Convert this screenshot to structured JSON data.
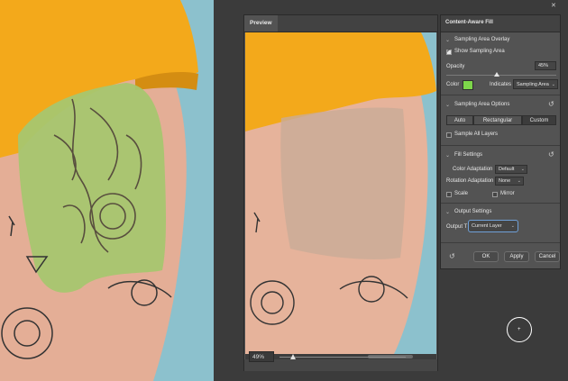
{
  "preview": {
    "tab_label": "Preview",
    "zoom": "49%"
  },
  "caf": {
    "title": "Content-Aware Fill",
    "sampling_overlay": {
      "heading": "Sampling Area Overlay",
      "show_label": "Show Sampling Area",
      "show_checked": true,
      "opacity_label": "Opacity",
      "opacity_value": "45%",
      "color_label": "Color",
      "color_swatch": "#7dd64a",
      "indicates_label": "Indicates",
      "indicates_value": "Sampling Area"
    },
    "sampling_options": {
      "heading": "Sampling Area Options",
      "auto": "Auto",
      "rectangular": "Rectangular",
      "custom": "Custom",
      "sample_all": "Sample All Layers"
    },
    "fill_settings": {
      "heading": "Fill Settings",
      "color_adapt_label": "Color Adaptation",
      "color_adapt_value": "Default",
      "rotation_label": "Rotation Adaptation",
      "rotation_value": "None",
      "scale_label": "Scale",
      "mirror_label": "Mirror"
    },
    "output_settings": {
      "heading": "Output Settings",
      "output_label": "Output T",
      "output_value": "Current Layer"
    },
    "buttons": {
      "ok": "OK",
      "apply": "Apply",
      "cancel": "Cancel"
    }
  },
  "colors": {
    "sampling_green": "#9fc56a",
    "shirt": "#f2a81e",
    "skin": "#e6b29a",
    "background": "#8cc1cd",
    "accent_focus": "#6fa0d8"
  },
  "icons": {
    "close": "close-icon",
    "menu": "panel-menu-icon",
    "reset": "reset-icon"
  }
}
